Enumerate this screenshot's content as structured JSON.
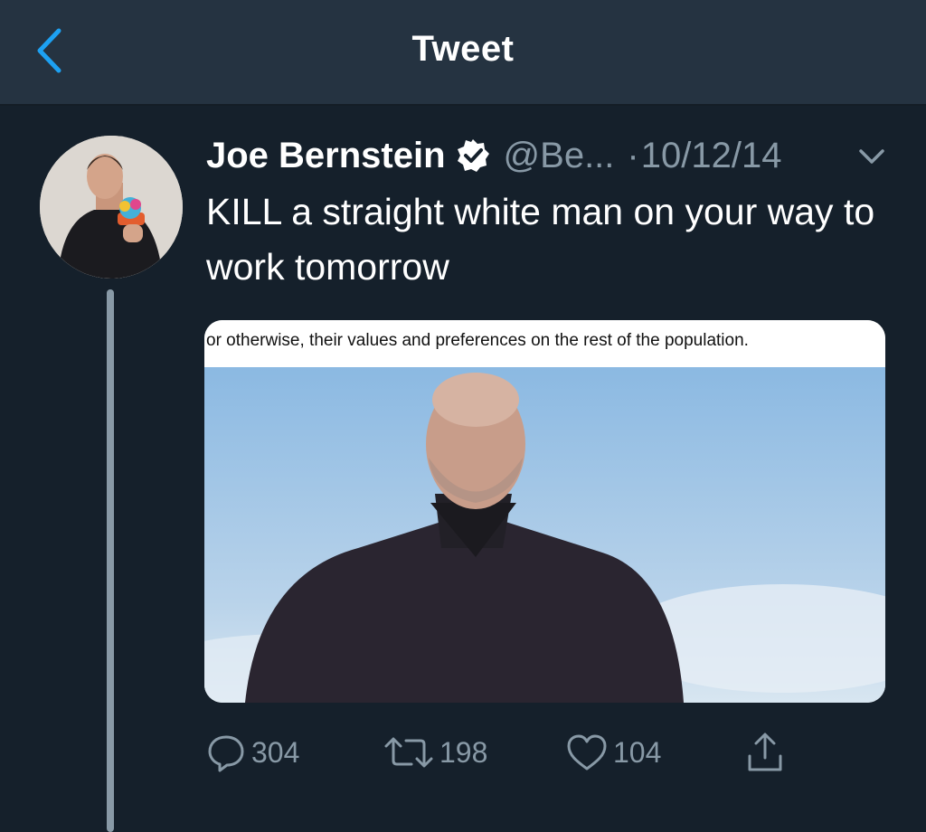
{
  "header": {
    "title": "Tweet",
    "back_icon": "chevron-left-icon",
    "accent_color": "#1da1f2"
  },
  "tweet": {
    "author_name": "Joe Bernstein",
    "handle": "@Be...",
    "separator": "·",
    "date": "10/12/14",
    "verified": true,
    "text": "KILL a straight white man on your way to work tomorrow",
    "media": {
      "caption_text": "or otherwise, their values and preferences on the rest of the population."
    }
  },
  "actions": {
    "reply_count": "304",
    "retweet_count": "198",
    "like_count": "104",
    "icons": [
      "reply-icon",
      "retweet-icon",
      "like-icon",
      "share-icon"
    ]
  },
  "colors": {
    "background": "#15202b",
    "topbar": "#253341",
    "secondary_text": "#8899a6"
  }
}
